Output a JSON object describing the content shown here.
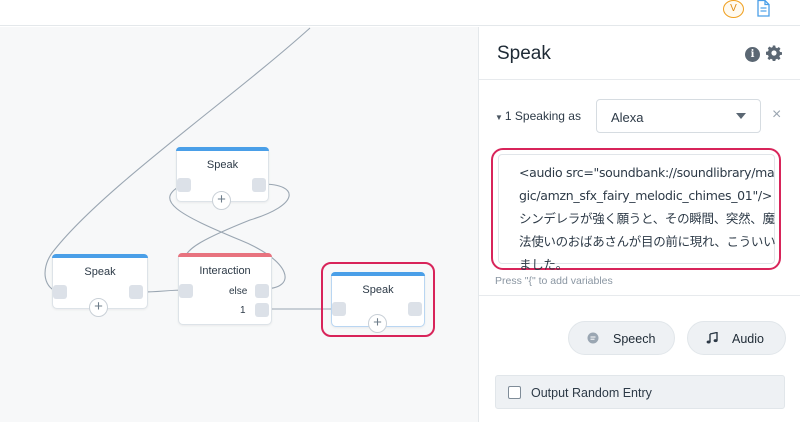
{
  "topbar": {
    "avatar_initial": "V",
    "doc_icon": "document-icon"
  },
  "canvas": {
    "nodes": [
      {
        "title": "Speak",
        "kind": "speak"
      },
      {
        "title": "Speak",
        "kind": "speak"
      },
      {
        "title": "Interaction",
        "kind": "interaction",
        "ports": [
          "else",
          "1"
        ]
      },
      {
        "title": "Speak",
        "kind": "speak",
        "selected": true
      }
    ],
    "add_glyph": "+"
  },
  "panel": {
    "title": "Speak",
    "info_icon": "info-icon",
    "gear_icon": "gear-icon",
    "speaking_count_label": "1 Speaking as",
    "voice_select": "Alexa",
    "close_glyph": "×",
    "ssml_text": "<audio src=\"soundbank://soundlibrary/magic/amzn_sfx_fairy_melodic_chimes_01\"/>シンデレラが強く願うと、その瞬間、突然、魔法使いのおばあさんが目の前に現れ、こういいました。",
    "hint": "Press \"{\" to add variables",
    "buttons": {
      "speech": "Speech",
      "audio": "Audio"
    },
    "random_entry_label": "Output Random Entry"
  },
  "colors": {
    "accent_highlight": "#d8245a",
    "node_blue": "#4a9fe8",
    "node_red": "#e8737f",
    "avatar_orange": "#f0a020"
  }
}
